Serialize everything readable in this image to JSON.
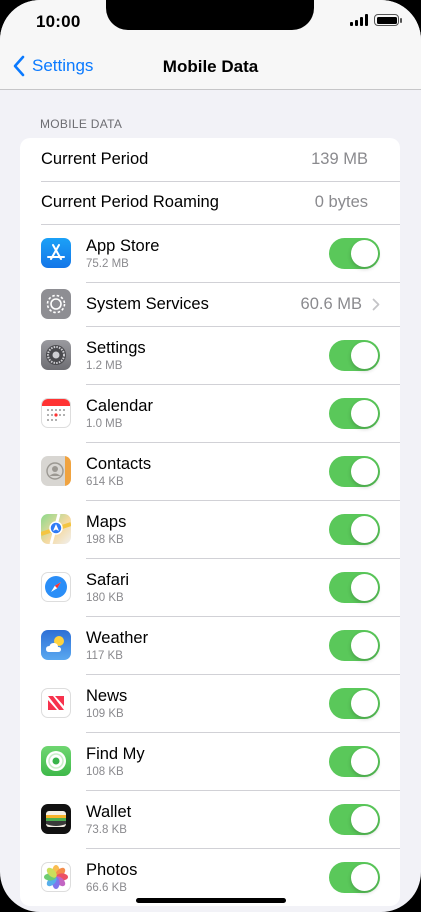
{
  "status": {
    "time": "10:00"
  },
  "nav": {
    "back_label": "Settings",
    "title": "Mobile Data"
  },
  "section": {
    "header": "MOBILE DATA"
  },
  "usage": [
    {
      "label": "Current Period",
      "value": "139 MB"
    },
    {
      "label": "Current Period Roaming",
      "value": "0 bytes"
    }
  ],
  "apps": [
    {
      "name": "App Store",
      "size": "75.2 MB",
      "icon": "app-store-icon",
      "enabled": true
    },
    {
      "name": "System Services",
      "value": "60.6 MB",
      "icon": "system-services-icon"
    },
    {
      "name": "Settings",
      "size": "1.2 MB",
      "icon": "settings-icon",
      "enabled": true
    },
    {
      "name": "Calendar",
      "size": "1.0 MB",
      "icon": "calendar-icon",
      "enabled": true
    },
    {
      "name": "Contacts",
      "size": "614 KB",
      "icon": "contacts-icon",
      "enabled": true
    },
    {
      "name": "Maps",
      "size": "198 KB",
      "icon": "maps-icon",
      "enabled": true
    },
    {
      "name": "Safari",
      "size": "180 KB",
      "icon": "safari-icon",
      "enabled": true
    },
    {
      "name": "Weather",
      "size": "117 KB",
      "icon": "weather-icon",
      "enabled": true
    },
    {
      "name": "News",
      "size": "109 KB",
      "icon": "news-icon",
      "enabled": true
    },
    {
      "name": "Find My",
      "size": "108 KB",
      "icon": "find-my-icon",
      "enabled": true
    },
    {
      "name": "Wallet",
      "size": "73.8 KB",
      "icon": "wallet-icon",
      "enabled": true
    },
    {
      "name": "Photos",
      "size": "66.6 KB",
      "icon": "photos-icon",
      "enabled": true
    }
  ],
  "colors": {
    "accent": "#0a7aff",
    "toggle_on": "#5ac85a",
    "background": "#f2f2f7"
  }
}
